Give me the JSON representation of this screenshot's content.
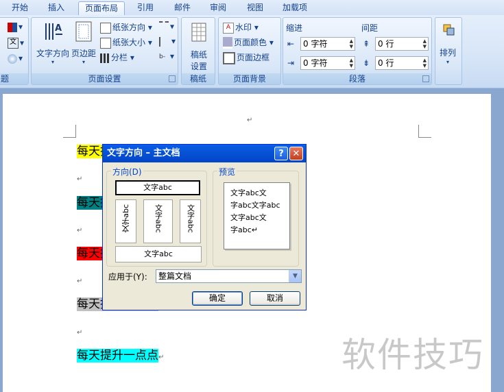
{
  "tabs": [
    {
      "label": "开始"
    },
    {
      "label": "插入"
    },
    {
      "label": "页面布局",
      "active": true
    },
    {
      "label": "引用"
    },
    {
      "label": "邮件"
    },
    {
      "label": "审阅"
    },
    {
      "label": "视图"
    },
    {
      "label": "加载项"
    }
  ],
  "ribbon": {
    "theme_group": {
      "label": "题"
    },
    "page_setup": {
      "label": "页面设置",
      "text_direction": "文字方向",
      "margins": "页边距",
      "orientation": "纸张方向",
      "size": "纸张大小",
      "columns": "分栏"
    },
    "draft": {
      "label": "稿纸",
      "button_line1": "稿纸",
      "button_line2": "设置"
    },
    "page_background": {
      "label": "页面背景",
      "watermark": "水印",
      "page_color": "页面颜色",
      "page_borders": "页面边框"
    },
    "paragraph": {
      "label": "段落",
      "indent": "缩进",
      "spacing": "间距",
      "indent_left": "0 字符",
      "indent_right": "0 字符",
      "spacing_before": "0 行",
      "spacing_after": "0 行"
    },
    "arrange": {
      "label": "排列"
    }
  },
  "document": {
    "lines": [
      {
        "text": "每天提升一点点",
        "color": "#ffff00"
      },
      {
        "text": "每天提升一点点",
        "color": "#008080"
      },
      {
        "text": "每天提升一点点",
        "color": "#ff0000"
      },
      {
        "text": "每天提升一点点",
        "color": "#c0c0c0"
      },
      {
        "text": "每天提升一点点",
        "color": "#00ffff"
      }
    ],
    "para_mark": "↵"
  },
  "watermark": "软件技巧",
  "dialog": {
    "title": "文字方向 – 主文档",
    "help": "?",
    "close": "✕",
    "direction_label": "方向(D)",
    "preview_label": "预览",
    "options": {
      "horizontal": "文字abc",
      "vert_left": "文字abc",
      "vert_stacked": "文字abc",
      "vert_right": "文字abc",
      "rotated": "文字abc"
    },
    "preview_lines": [
      "文字abc文",
      "字abc文字abc",
      "文字abc文",
      "字abc↵"
    ],
    "apply_to_label": "应用于(Y):",
    "apply_to_value": "整篇文档",
    "ok": "确定",
    "cancel": "取消"
  }
}
